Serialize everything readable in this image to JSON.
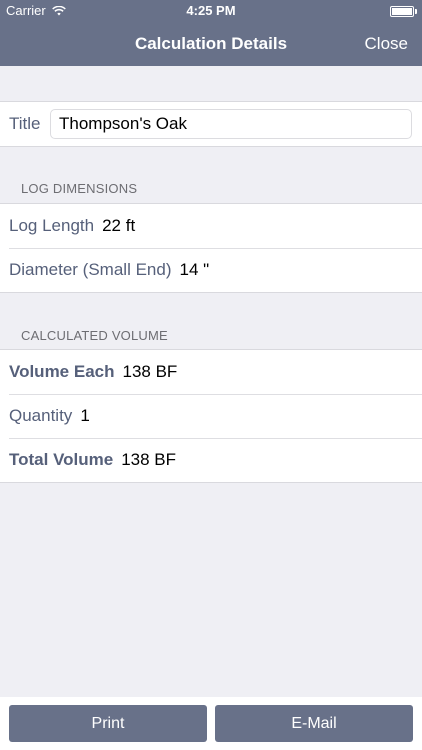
{
  "status": {
    "carrier": "Carrier",
    "time": "4:25 PM"
  },
  "nav": {
    "title": "Calculation Details",
    "close_label": "Close"
  },
  "title_row": {
    "label": "Title",
    "value": "Thompson's Oak"
  },
  "log_dimensions": {
    "header": "LOG DIMENSIONS",
    "length_label": "Log Length",
    "length_value": "22 ft",
    "diameter_label": "Diameter (Small End)",
    "diameter_value": "14 \""
  },
  "calculated_volume": {
    "header": "CALCULATED VOLUME",
    "each_label": "Volume Each",
    "each_value": "138 BF",
    "quantity_label": "Quantity",
    "quantity_value": "1",
    "total_label": "Total Volume",
    "total_value": "138 BF"
  },
  "actions": {
    "print_label": "Print",
    "email_label": "E-Mail"
  },
  "colors": {
    "accent": "#687189",
    "label": "#56607a",
    "background": "#efeff4"
  },
  "icons": {
    "signal": "wifi-icon",
    "battery": "battery-icon"
  }
}
